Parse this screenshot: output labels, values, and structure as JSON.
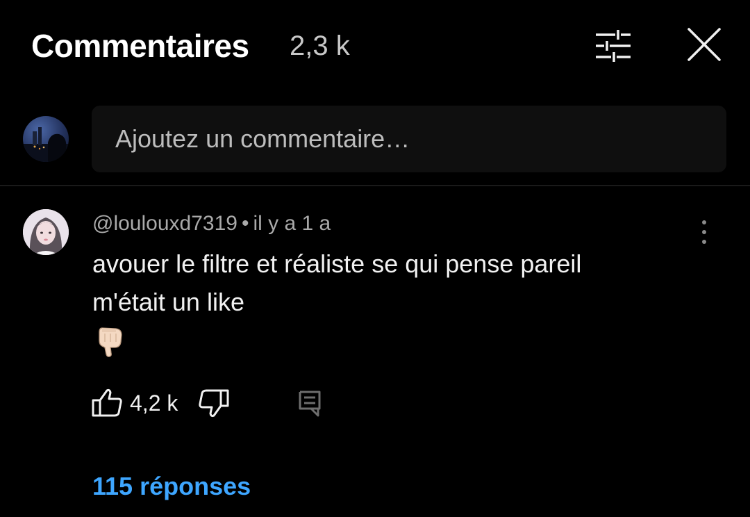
{
  "header": {
    "title": "Commentaires",
    "count": "2,3 k"
  },
  "composer": {
    "placeholder": "Ajoutez un commentaire…"
  },
  "comment": {
    "author": "@loulouxd7319",
    "separator": "•",
    "time": "il y a 1 a",
    "line1": "avouer le filtre et réaliste se qui pense pareil",
    "line2": "m'était un like",
    "emoji": "👇🏻",
    "likes": "4,2 k",
    "replies_link": "115 réponses"
  },
  "colors": {
    "background": "#000000",
    "text": "#f1f1f1",
    "muted": "#aaaaaa",
    "link": "#3ea6ff",
    "input_bg": "#0f0f0f"
  },
  "icons": {
    "filter": "sliders-icon",
    "close": "close-icon",
    "more": "vertical-dots-icon",
    "like": "thumbs-up-icon",
    "dislike": "thumbs-down-icon",
    "reply": "reply-comment-icon",
    "emoji": "pointing-down-hand-icon"
  }
}
